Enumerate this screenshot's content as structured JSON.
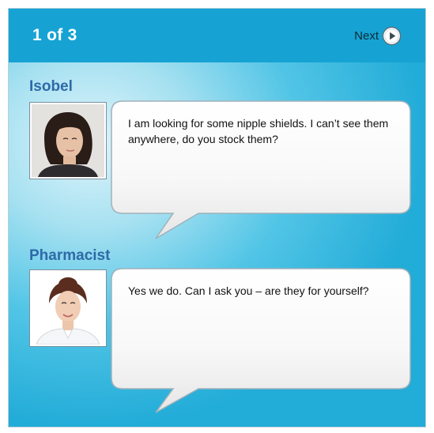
{
  "header": {
    "counter": "1 of 3",
    "next_label": "Next",
    "next_icon": "play-circle-icon"
  },
  "colors": {
    "header_bg": "#16a3d3",
    "speaker_name": "#2e6aa8",
    "bubble_bg": "#f6f6f6"
  },
  "conversation": [
    {
      "speaker": "Isobel",
      "message": "I am looking for some nipple shields. I can’t see them anywhere, do you stock them?"
    },
    {
      "speaker": "Pharmacist",
      "message": "Yes we do. Can I ask you – are they for yourself?"
    }
  ]
}
